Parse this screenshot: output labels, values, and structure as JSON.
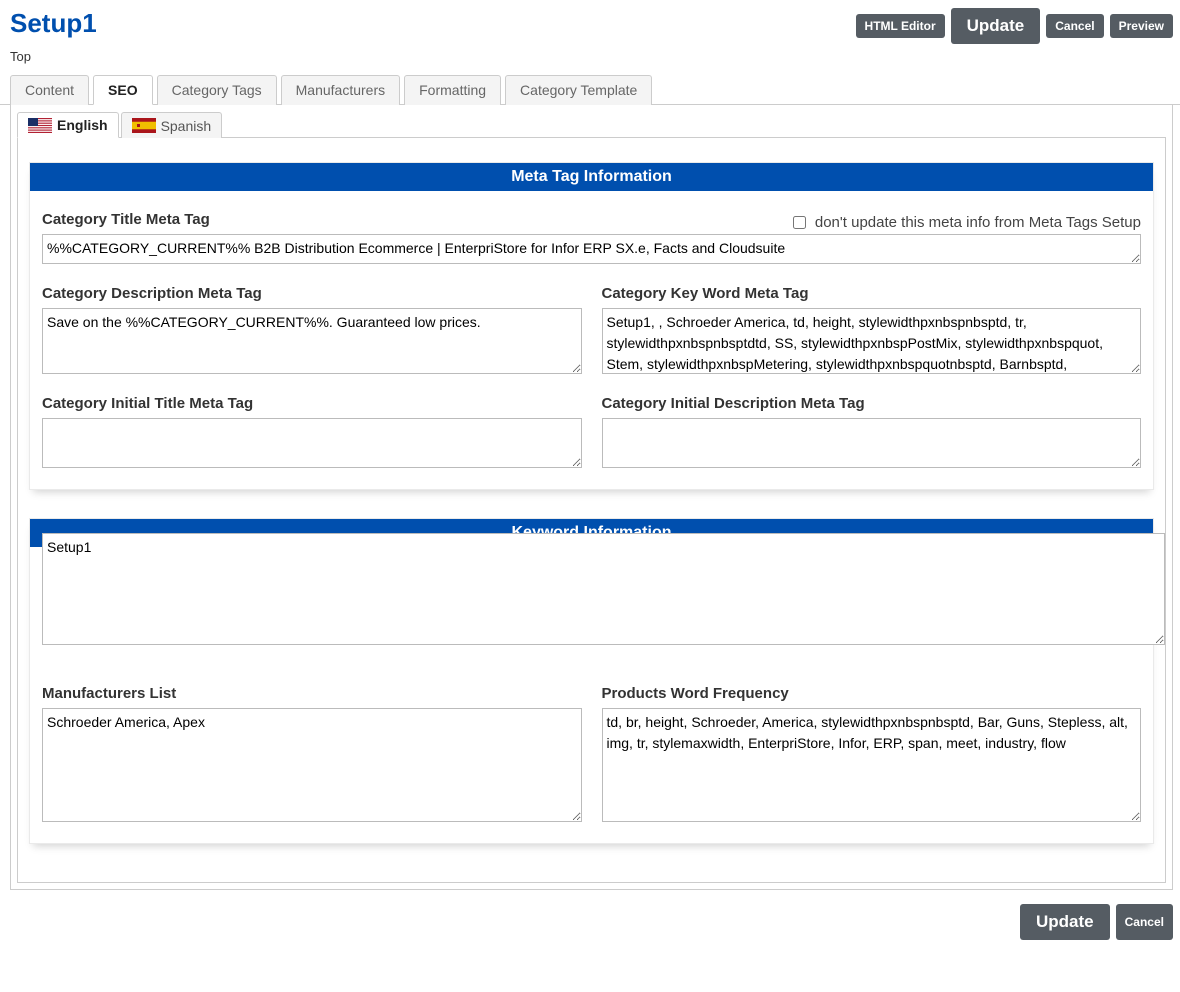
{
  "page_title": "Setup1",
  "breadcrumb": "Top",
  "buttons": {
    "html_editor": "HTML Editor",
    "update_top": "Update",
    "cancel_top": "Cancel",
    "preview": "Preview",
    "update_bottom": "Update",
    "cancel_bottom": "Cancel"
  },
  "main_tabs": [
    {
      "id": "content",
      "label": "Content"
    },
    {
      "id": "seo",
      "label": "SEO"
    },
    {
      "id": "category-tags",
      "label": "Category Tags"
    },
    {
      "id": "manufacturers",
      "label": "Manufacturers"
    },
    {
      "id": "formatting",
      "label": "Formatting"
    },
    {
      "id": "category-template",
      "label": "Category Template"
    }
  ],
  "active_main_tab": "seo",
  "lang_tabs": [
    {
      "id": "english",
      "label": "English"
    },
    {
      "id": "spanish",
      "label": "Spanish"
    }
  ],
  "active_lang_tab": "english",
  "meta_section": {
    "title": "Meta Tag Information",
    "labels": {
      "category_title": "Category Title Meta Tag",
      "dont_update": "don't update this meta info from Meta Tags Setup",
      "category_description": "Category Description Meta Tag",
      "category_keyword": "Category Key Word Meta Tag",
      "initial_title": "Category Initial Title Meta Tag",
      "initial_description": "Category Initial Description Meta Tag"
    },
    "values": {
      "category_title": "%%CATEGORY_CURRENT%% B2B Distribution Ecommerce | EnterpriStore for Infor ERP SX.e, Facts and Cloudsuite",
      "dont_update_checked": false,
      "category_description": "Save on the %%CATEGORY_CURRENT%%. Guaranteed low prices.",
      "category_keyword": "Setup1, , Schroeder America, td, height, stylewidthpxnbspnbsptd, tr, stylewidthpxnbspnbsptdtd, SS, stylewidthpxnbspPostMix, stylewidthpxnbspquot, Stem, stylewidthpxnbspMetering, stylewidthpxnbspquotnbsptd, Barnbsptd, ",
      "initial_title": "",
      "initial_description": ""
    }
  },
  "keyword_section": {
    "title": "Keyword Information",
    "values": {
      "keywords": "Setup1"
    },
    "labels": {
      "manufacturers_list": "Manufacturers List",
      "products_word_frequency": "Products Word Frequency"
    },
    "manufacturers_list": "Schroeder America, Apex",
    "products_word_frequency": "td, br, height, Schroeder, America, stylewidthpxnbspnbsptd, Bar, Guns, Stepless, alt, img, tr, stylemaxwidth, EnterpriStore, Infor, ERP, span, meet, industry, flow"
  }
}
